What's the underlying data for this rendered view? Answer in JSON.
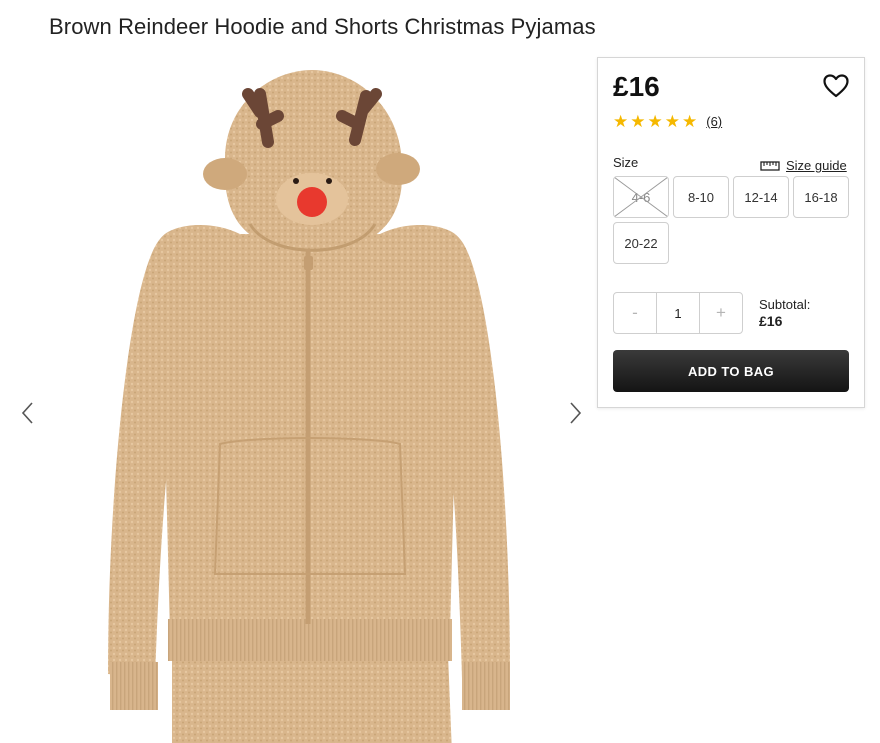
{
  "product": {
    "title": "Brown Reindeer Hoodie and Shorts Christmas Pyjamas",
    "price": "£16",
    "rating": 4.5,
    "review_count": "(6)"
  },
  "icons": {
    "wishlist": "heart-icon",
    "size_guide": "ruler-icon",
    "prev": "chevron-left-icon",
    "next": "chevron-right-icon",
    "star": "star-icon"
  },
  "size": {
    "label": "Size",
    "guide_label": "Size guide",
    "options": [
      {
        "label": "4-6",
        "available": false
      },
      {
        "label": "8-10",
        "available": true
      },
      {
        "label": "12-14",
        "available": true
      },
      {
        "label": "16-18",
        "available": true
      },
      {
        "label": "20-22",
        "available": true
      }
    ]
  },
  "quantity": {
    "minus": "-",
    "value": "1",
    "plus": "+"
  },
  "subtotal": {
    "label": "Subtotal:",
    "amount": "£16"
  },
  "add_to_bag": "ADD TO BAG",
  "colors": {
    "star": "#f5b800",
    "button": "#1e1e1e",
    "fabric": "#d7b48a",
    "antler": "#6b4636",
    "nose": "#e8392e"
  }
}
